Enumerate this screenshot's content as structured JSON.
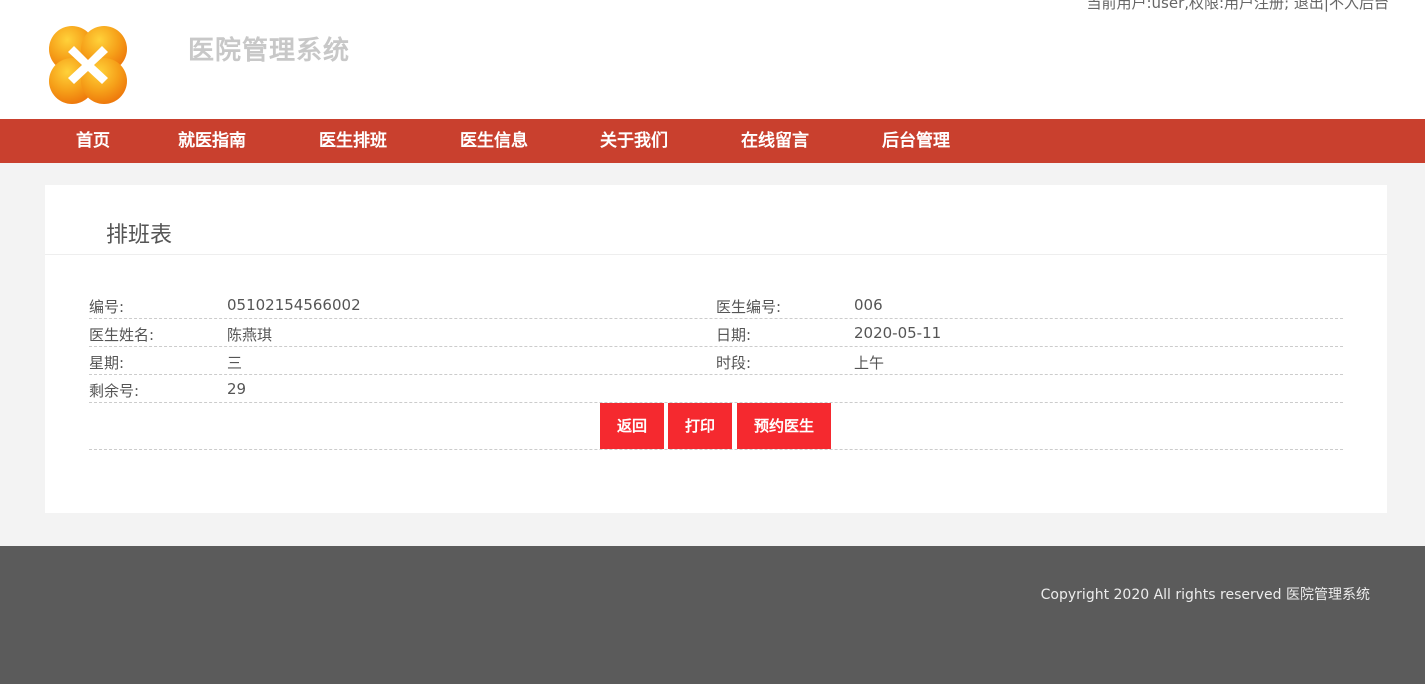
{
  "header": {
    "site_title": "医院管理系统",
    "user_label": "当前用户:user,权限:用户注册;",
    "logout_label": "退出",
    "admin_label": "不入后台"
  },
  "nav": {
    "items": [
      "首页",
      "就医指南",
      "医生排班",
      "医生信息",
      "关于我们",
      "在线留言",
      "后台管理"
    ]
  },
  "panel": {
    "title": "排班表",
    "rows": [
      {
        "label1": "编号:",
        "value1": "05102154566002",
        "label2": "医生编号:",
        "value2": "006"
      },
      {
        "label1": "医生姓名:",
        "value1": "陈燕琪",
        "label2": "日期:",
        "value2": "2020-05-11"
      },
      {
        "label1": "星期:",
        "value1": "三",
        "label2": "时段:",
        "value2": "上午"
      },
      {
        "label1": "剩余号:",
        "value1": "29",
        "label2": "",
        "value2": ""
      }
    ],
    "buttons": {
      "back": "返回",
      "print": "打印",
      "book": "预约医生"
    }
  },
  "colors": {
    "nav_bg": "#c9402e",
    "button_bg": "#f5292f",
    "footer_bg": "#5b5b5b",
    "logo_orange": "#f39a1c"
  },
  "footer": {
    "copyright": "Copyright 2020 All rights reserved 医院管理系统"
  }
}
